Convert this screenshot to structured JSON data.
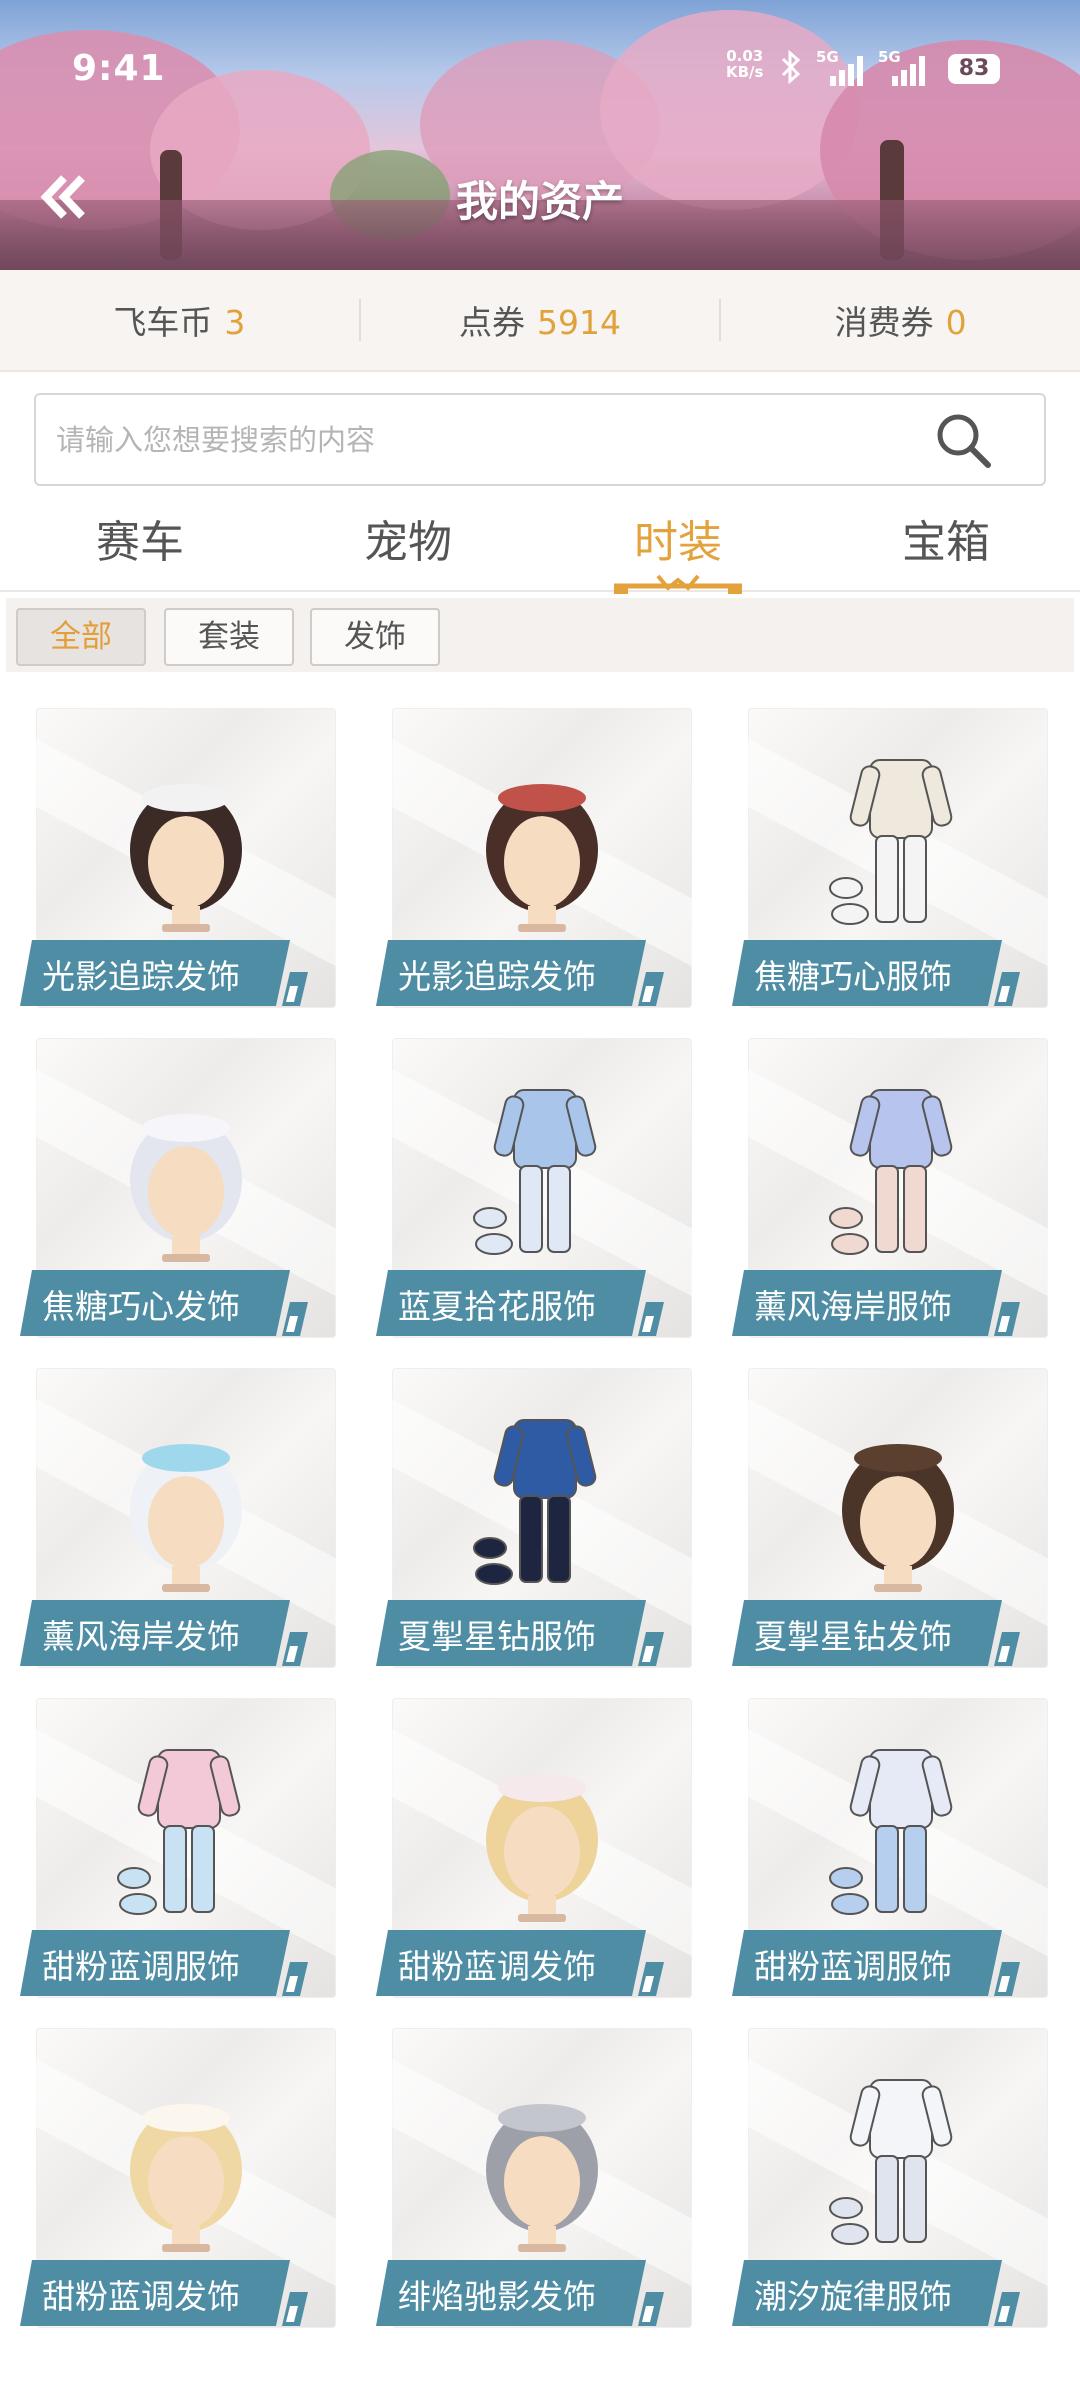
{
  "status_bar": {
    "time": "9:41",
    "net_speed": "0.03",
    "net_unit": "KB/s",
    "sim1": "5G",
    "sim2": "5G",
    "battery": "83"
  },
  "header": {
    "title": "我的资产",
    "back_icon": "double-chevron-left-icon"
  },
  "currencies": [
    {
      "label": "飞车币",
      "value": "3"
    },
    {
      "label": "点券",
      "value": "5914"
    },
    {
      "label": "消费券",
      "value": "0"
    }
  ],
  "search": {
    "placeholder": "请输入您想要搜索的内容",
    "icon": "search-icon"
  },
  "tabs": [
    {
      "label": "赛车"
    },
    {
      "label": "宠物"
    },
    {
      "label": "时装",
      "active": true
    },
    {
      "label": "宝箱"
    }
  ],
  "filters": [
    {
      "label": "全部",
      "active": true
    },
    {
      "label": "套装"
    },
    {
      "label": "发饰"
    }
  ],
  "items": [
    {
      "name": "光影追踪发饰",
      "kind": "hair-dark-bun"
    },
    {
      "name": "光影追踪发饰",
      "kind": "hair-dark-band"
    },
    {
      "name": "焦糖巧心服饰",
      "kind": "outfit-cream"
    },
    {
      "name": "焦糖巧心发饰",
      "kind": "hair-silver"
    },
    {
      "name": "蓝夏拾花服饰",
      "kind": "outfit-blue"
    },
    {
      "name": "薰风海岸服饰",
      "kind": "outfit-lilac"
    },
    {
      "name": "薰风海岸发饰",
      "kind": "hair-white-goggles"
    },
    {
      "name": "夏掣星钻服饰",
      "kind": "outfit-navy"
    },
    {
      "name": "夏掣星钻发饰",
      "kind": "hair-brown"
    },
    {
      "name": "甜粉蓝调服饰",
      "kind": "outfit-pink"
    },
    {
      "name": "甜粉蓝调发饰",
      "kind": "hair-blonde-long"
    },
    {
      "name": "甜粉蓝调服饰",
      "kind": "outfit-pastel"
    },
    {
      "name": "甜粉蓝调发饰",
      "kind": "hair-blonde-ears"
    },
    {
      "name": "绯焰驰影发饰",
      "kind": "hair-grey"
    },
    {
      "name": "潮汐旋律服饰",
      "kind": "outfit-white"
    }
  ]
}
